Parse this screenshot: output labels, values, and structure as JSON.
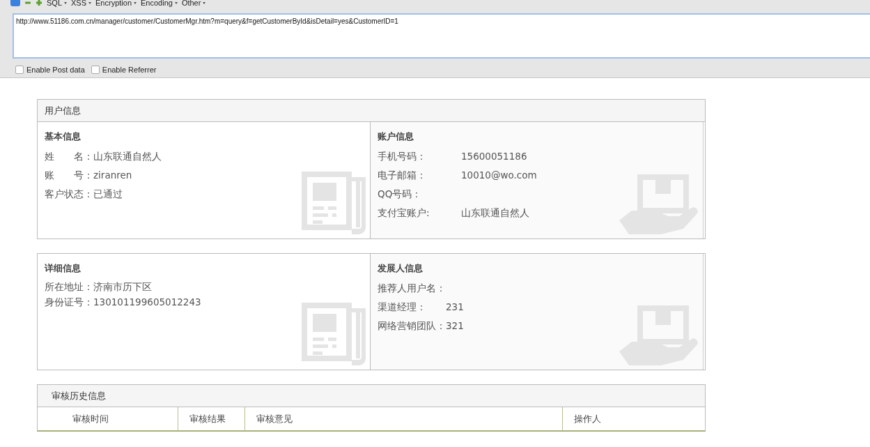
{
  "toolbar": {
    "menus": [
      {
        "label": "SQL"
      },
      {
        "label": "XSS"
      },
      {
        "label": "Encryption"
      },
      {
        "label": "Encoding"
      },
      {
        "label": "Other"
      }
    ]
  },
  "url_field": {
    "value": "http://www.51186.com.cn/manager/customer/CustomerMgr.htm?m=query&f=getCustomerById&isDetail=yes&CustomerID=1"
  },
  "options": [
    {
      "label": "Enable Post data",
      "checked": false
    },
    {
      "label": "Enable Referrer",
      "checked": false
    }
  ],
  "user_panel": {
    "title": "用户信息",
    "sections": [
      {
        "title": "基本信息",
        "fields": [
          {
            "label": "姓　　名：",
            "value": "山东联通自然人"
          },
          {
            "label": "账　　号：",
            "value": "ziranren"
          },
          {
            "label": "客户状态：",
            "value": "已通过"
          }
        ]
      },
      {
        "title": "账户信息",
        "fields": [
          {
            "label": "手机号码：",
            "value": "15600051186"
          },
          {
            "label": "电子邮箱：",
            "value": "10010@wo.com"
          },
          {
            "label": "QQ号码："
          },
          {
            "label": "支付宝账户:",
            "value": "山东联通自然人"
          }
        ]
      }
    ]
  },
  "detail_panel": {
    "sections": [
      {
        "title": "详细信息",
        "fields": [
          {
            "label": "所在地址：",
            "value": "济南市历下区"
          },
          {
            "label": "身份证号：",
            "value": "130101199605012243"
          }
        ]
      },
      {
        "title": "发展人信息",
        "fields": [
          {
            "label": "推荐人用户名："
          },
          {
            "label": "渠道经理：",
            "value": "231"
          },
          {
            "label": "网络营销团队：",
            "value": "321"
          }
        ]
      }
    ]
  },
  "history_panel": {
    "title": "审核历史信息",
    "columns": [
      "审核时间",
      "审核结果",
      "审核意见",
      "操作人"
    ]
  }
}
